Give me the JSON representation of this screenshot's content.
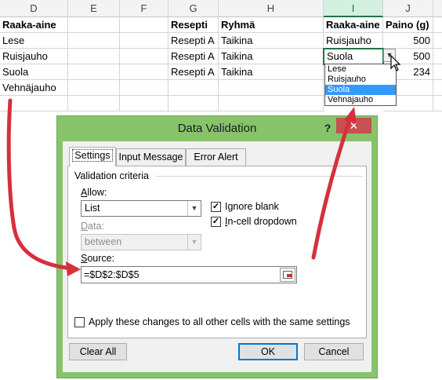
{
  "spreadsheet": {
    "columns": [
      "D",
      "E",
      "F",
      "G",
      "H",
      "I",
      "J"
    ],
    "selected_column": "I",
    "ingredient_list": {
      "header": "Raaka-aine",
      "items": [
        "Lese",
        "Ruisjauho",
        "Suola",
        "Vehnäjauho"
      ]
    },
    "table": {
      "headers": [
        "Resepti",
        "Ryhmä",
        "Raaka-aine",
        "Paino (g)"
      ],
      "rows": [
        [
          "Resepti A",
          "Taikina",
          "Ruisjauho",
          "500"
        ],
        [
          "Resepti A",
          "Taikina",
          "Suola",
          "500"
        ],
        [
          "Resepti A",
          "Taikina",
          "",
          "234"
        ]
      ]
    },
    "dropdown": {
      "arrow": "▼",
      "options": [
        "Lese",
        "Ruisjauho",
        "Suola",
        "Vehnäjauho"
      ],
      "highlighted": "Suola"
    }
  },
  "dialog": {
    "title": "Data Validation",
    "help_label": "?",
    "close_label": "✕",
    "tabs": [
      "Settings",
      "Input Message",
      "Error Alert"
    ],
    "active_tab": "Settings",
    "group_title": "Validation criteria",
    "allow_label": "Allow:",
    "allow_value": "List",
    "data_label": "Data:",
    "data_value": "between",
    "ignore_blank_label": "Ignore blank",
    "in_cell_dropdown_label": "In-cell dropdown",
    "ignore_blank_checked": true,
    "in_cell_dropdown_checked": true,
    "check_mark": "✓",
    "combo_arrow": "▼",
    "source_label": "Source:",
    "source_value": "=$D$2:$D$5",
    "apply_all_label": "Apply these changes to all other cells with the same settings",
    "apply_all_checked": false,
    "clear_all_label": "Clear All",
    "ok_label": "OK",
    "cancel_label": "Cancel"
  },
  "colors": {
    "excel_green": "#217346",
    "dialog_frame": "#86c36b",
    "close_button": "#c75050",
    "highlight": "#3399ff",
    "arrow_red": "#d6303d"
  }
}
